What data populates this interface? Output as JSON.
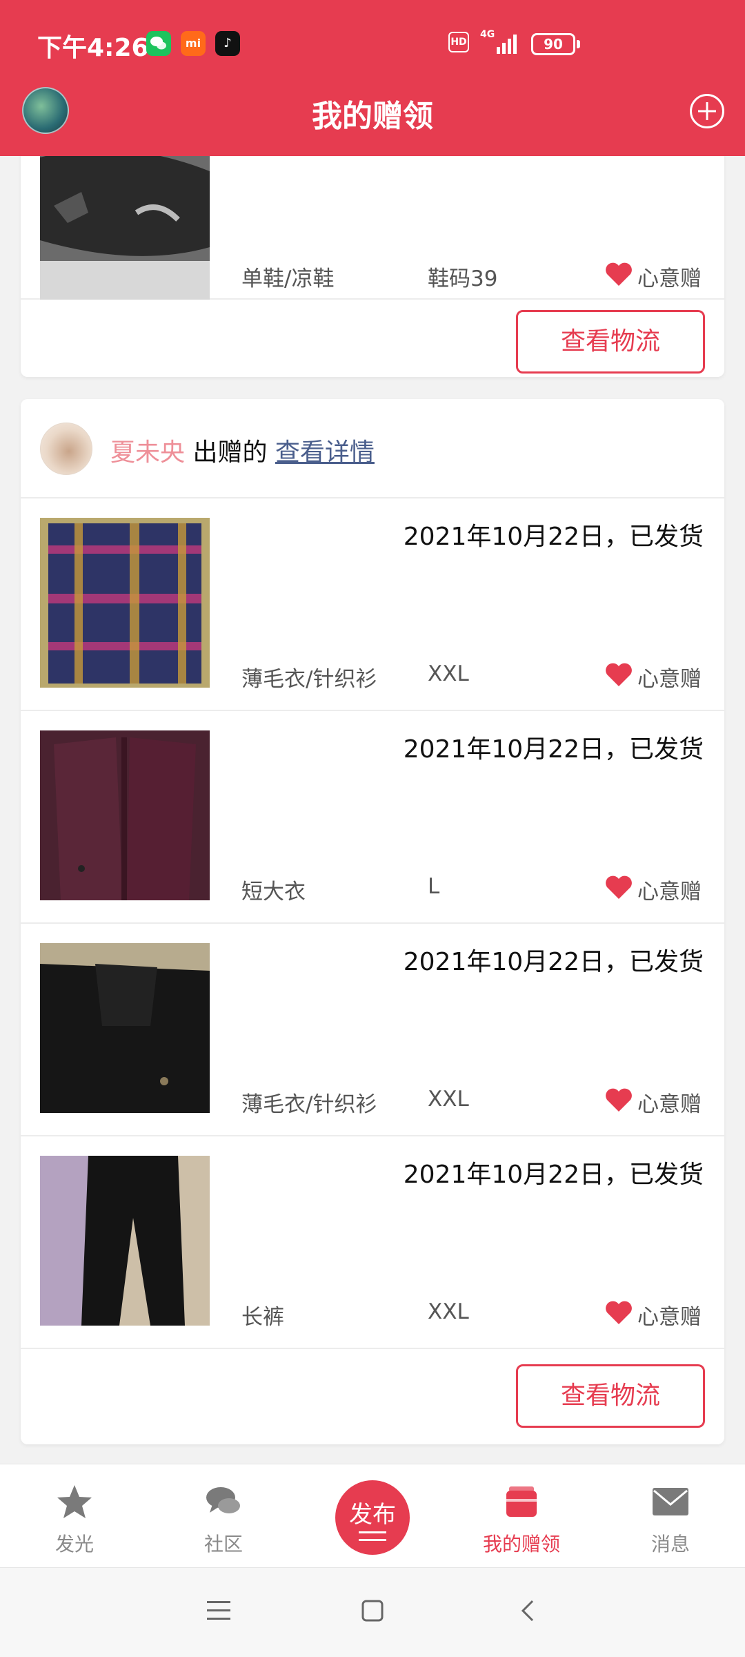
{
  "status_bar": {
    "time": "下午4:26",
    "hd": "HD",
    "network": "4G",
    "battery": "90"
  },
  "header": {
    "title": "我的赠领"
  },
  "card_top": {
    "item": {
      "category": "单鞋/凉鞋",
      "size": "鞋码39",
      "gift_type": "心意赠"
    },
    "logistics_button": "查看物流"
  },
  "card_main": {
    "donor_name": "夏未央",
    "donated_text": " 出赠的 ",
    "detail_link": "查看详情",
    "items": [
      {
        "date_status": "2021年10月22日，已发货",
        "category": "薄毛衣/针织衫",
        "size": "XXL",
        "gift_type": "心意赠"
      },
      {
        "date_status": "2021年10月22日，已发货",
        "category": "短大衣",
        "size": "L",
        "gift_type": "心意赠"
      },
      {
        "date_status": "2021年10月22日，已发货",
        "category": "薄毛衣/针织衫",
        "size": "XXL",
        "gift_type": "心意赠"
      },
      {
        "date_status": "2021年10月22日，已发货",
        "category": "长裤",
        "size": "XXL",
        "gift_type": "心意赠"
      }
    ],
    "logistics_button": "查看物流"
  },
  "bottom_nav": {
    "items": [
      {
        "label": "发光",
        "icon": "star-icon"
      },
      {
        "label": "社区",
        "icon": "chat-bubbles-icon"
      },
      {
        "label": "发布",
        "icon": "publish-icon"
      },
      {
        "label": "我的赠领",
        "icon": "gift-box-icon",
        "active": true
      },
      {
        "label": "消息",
        "icon": "envelope-icon"
      }
    ]
  },
  "colors": {
    "primary": "#e63c50",
    "donor_name": "#ee8f98",
    "link": "#4a5e8c"
  }
}
